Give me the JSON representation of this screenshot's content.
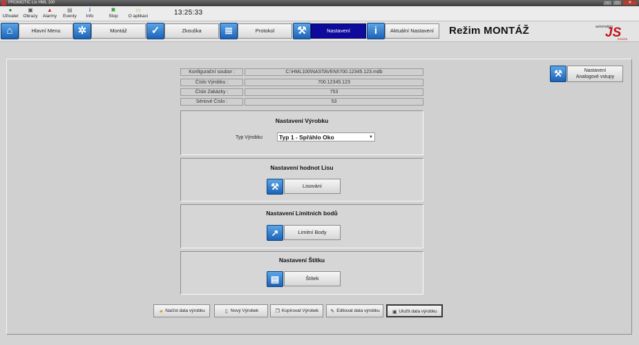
{
  "window": {
    "title": "PROMOTIC Lis HML 100"
  },
  "toolbar": {
    "items": [
      {
        "label": "Uživatel",
        "icon": "user-icon",
        "color": "#2e7d32"
      },
      {
        "label": "Obrazy",
        "icon": "images-icon",
        "color": "#555555"
      },
      {
        "label": "Alarmy",
        "icon": "alarm-icon",
        "color": "#c62828"
      },
      {
        "label": "Eventy",
        "icon": "events-icon",
        "color": "#666666"
      },
      {
        "label": "Info",
        "icon": "info-icon",
        "color": "#1565c0"
      },
      {
        "label": "Stop",
        "icon": "stop-icon",
        "color": "#2e9e2e"
      },
      {
        "label": "O aplikaci",
        "icon": "about-icon",
        "color": "#b59a2a"
      }
    ],
    "clock": "13:25:33"
  },
  "nav": {
    "items": [
      {
        "label": "Hlavní Menu",
        "icon": "home-icon",
        "active": false
      },
      {
        "label": "Montáž",
        "icon": "gears-icon",
        "active": false
      },
      {
        "label": "Zkouška",
        "icon": "check-icon",
        "active": false
      },
      {
        "label": "Protokol",
        "icon": "document-icon",
        "active": false
      },
      {
        "label": "Nastavení",
        "icon": "wrench-icon",
        "active": true
      },
      {
        "label": "Aktuální Nastavení",
        "icon": "info-icon",
        "active": false
      }
    ],
    "mode_title": "Režim MONTÁŽ"
  },
  "logo": {
    "line1": "automation",
    "main": "JS",
    "line2": "service"
  },
  "info_table": [
    {
      "label": "Konfigurační soubor :",
      "value": "C:\\HML100\\NASTAVENI\\700.12345.123.mdb"
    },
    {
      "label": "Číslo Výrobku :",
      "value": "700.12345.123"
    },
    {
      "label": "Číslo Zakázky :",
      "value": "753"
    },
    {
      "label": "Sériové Číslo :",
      "value": "53"
    }
  ],
  "sections": {
    "product": {
      "title": "Nastavení Výrobku",
      "type_label": "Typ Výrobku",
      "type_value": "Typ 1 - Spřáhlo Oko"
    },
    "press": {
      "title": "Nastavení hodnot Lisu",
      "button": "Lisování",
      "icon": "wrench-icon"
    },
    "limits": {
      "title": "Nastavení Limitních bodů",
      "button": "Limitní Body",
      "icon": "chart-icon"
    },
    "label": {
      "title": "Nastavení Štítku",
      "button": "Štítek",
      "icon": "printer-icon"
    }
  },
  "side_button": {
    "line1": "Nastavení",
    "line2": "Analogové vstupy",
    "icon": "wrench-icon"
  },
  "bottom_buttons": [
    {
      "label": "Načíst data výrobku",
      "icon": "folder-open-icon"
    },
    {
      "label": "Nový Výrobek",
      "icon": "new-document-icon"
    },
    {
      "label": "Kopírovat Výrobek",
      "icon": "copy-icon"
    },
    {
      "label": "Editovat data výrobku",
      "icon": "edit-icon"
    },
    {
      "label": "Uložit data výrobku",
      "icon": "save-icon"
    }
  ],
  "colors": {
    "active_nav": "#0d0a9c",
    "icon_blue": "#1d62b5",
    "logo_red": "#c0141b"
  }
}
